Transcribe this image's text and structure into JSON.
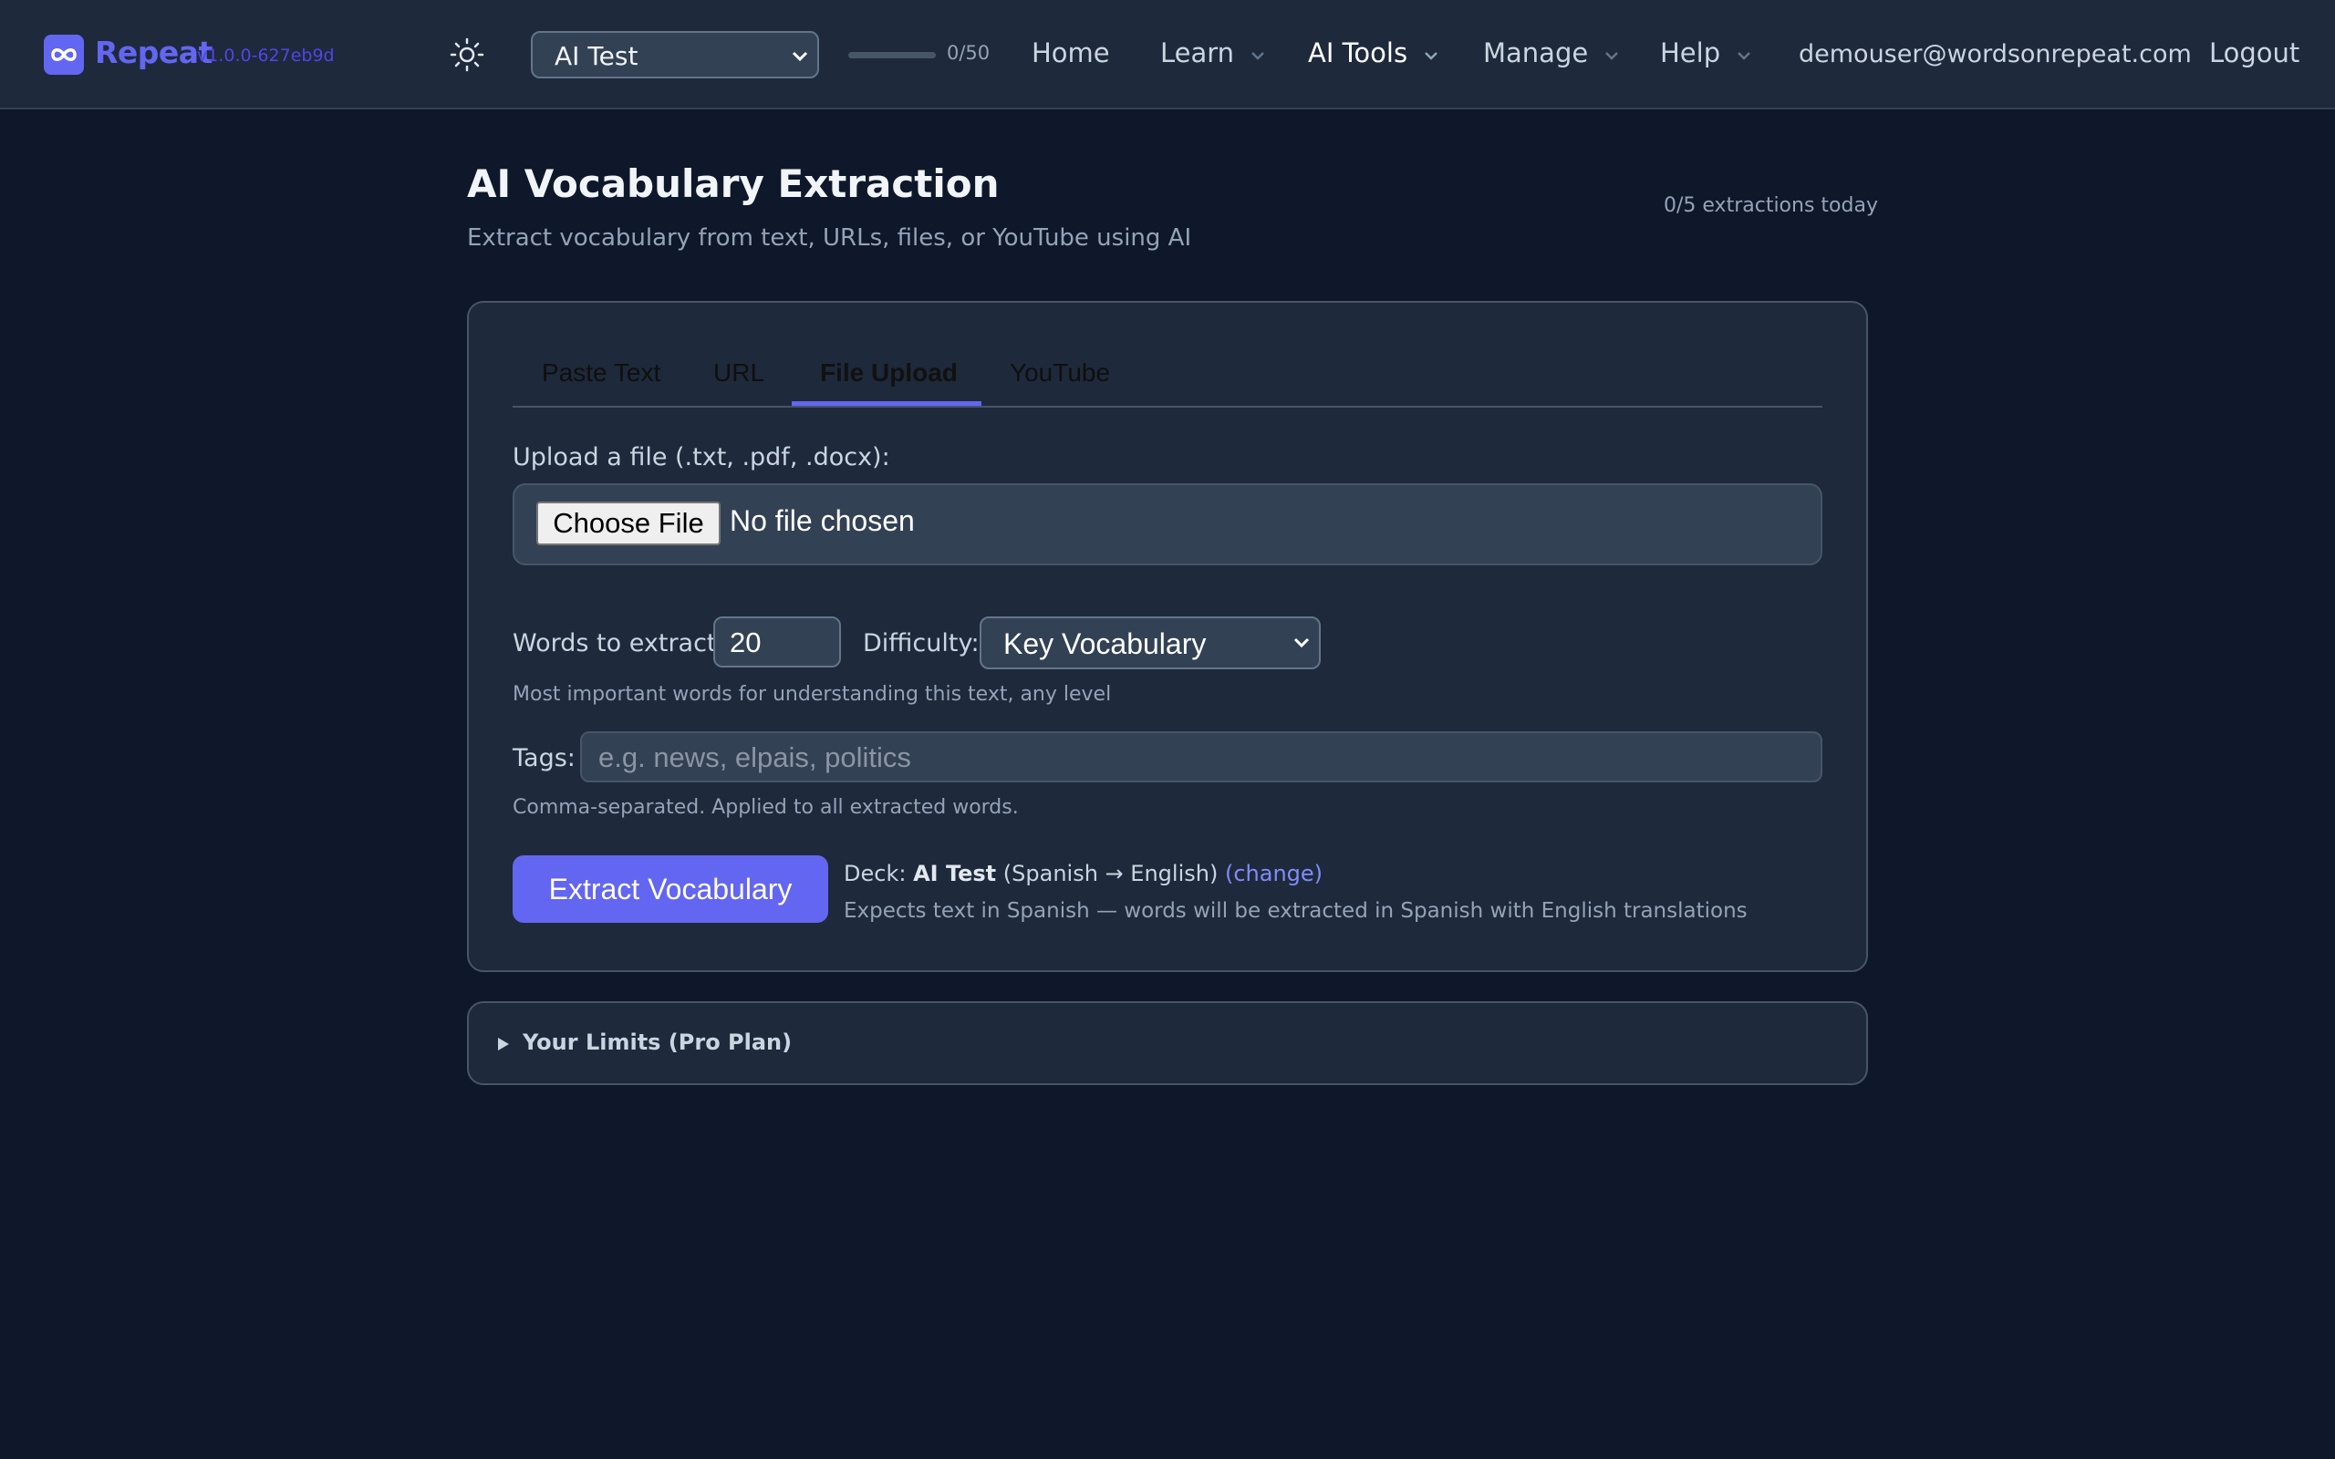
{
  "nav": {
    "brand": "Repeat",
    "version": "v1.0.0-627eb9d",
    "deck_selected": "AI Test",
    "progress_text": "0/50",
    "progress_fraction": 0,
    "links": {
      "home": "Home",
      "learn": "Learn",
      "ai_tools": "AI Tools",
      "manage": "Manage",
      "help": "Help"
    },
    "user_email": "demouser@wordsonrepeat.com",
    "logout": "Logout",
    "icons": {
      "logo": "infinity-icon",
      "theme": "sun-icon",
      "dropdown": "chevron-down-icon"
    }
  },
  "header": {
    "title": "AI Vocabulary Extraction",
    "subtitle": "Extract vocabulary from text, URLs, files, or YouTube using AI",
    "quota": "0/5 extractions today"
  },
  "tabs": [
    {
      "label": "Paste Text",
      "active": false
    },
    {
      "label": "URL",
      "active": false
    },
    {
      "label": "File Upload",
      "active": true
    },
    {
      "label": "YouTube",
      "active": false
    }
  ],
  "upload": {
    "label": "Upload a file (.txt, .pdf, .docx):",
    "button": "Choose File",
    "status": "No file chosen"
  },
  "options": {
    "words_label": "Words to extract:",
    "words_value": "20",
    "difficulty_label": "Difficulty:",
    "difficulty_value": "Key Vocabulary",
    "difficulty_hint": "Most important words for understanding this text, any level"
  },
  "tags": {
    "label": "Tags:",
    "placeholder": "e.g. news, elpais, politics",
    "hint": "Comma-separated. Applied to all extracted words."
  },
  "extract": {
    "button": "Extract Vocabulary",
    "deck_prefix": "Deck:",
    "deck_name": "AI Test",
    "deck_langs": "(Spanish → English)",
    "change_link": "(change)",
    "expects": "Expects text in Spanish — words will be extracted in Spanish with English translations"
  },
  "limits": {
    "label": "Your Limits (Pro Plan)"
  },
  "colors": {
    "accent": "#6366f1",
    "background": "#0f172a",
    "surface": "#1e293b"
  }
}
